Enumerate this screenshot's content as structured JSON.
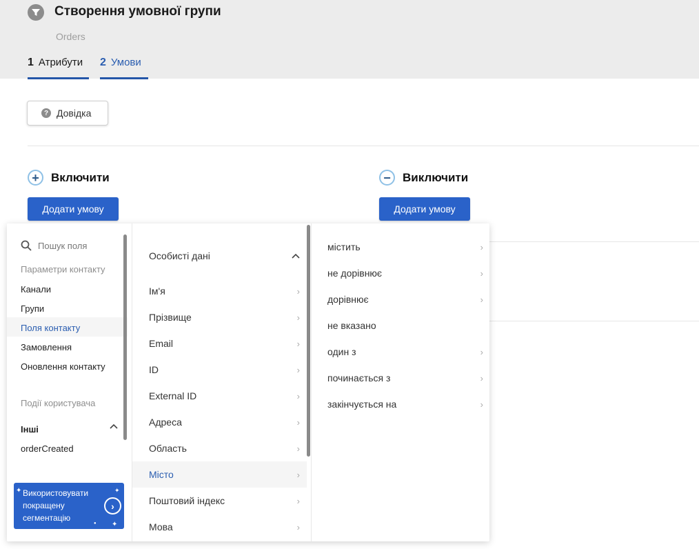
{
  "header": {
    "title": "Створення умовної групи",
    "subtitle": "Orders",
    "steps": [
      {
        "num": "1",
        "label": "Атрибути"
      },
      {
        "num": "2",
        "label": "Умови"
      }
    ]
  },
  "help_label": "Довідка",
  "include": {
    "label": "Включити",
    "button": "Додати умову"
  },
  "exclude": {
    "label": "Виключити",
    "button": "Додати умову"
  },
  "field_menu": {
    "search_placeholder": "Пошук поля",
    "contact_params_label": "Параметри контакту",
    "contact_items": [
      "Канали",
      "Групи",
      "Поля контакту",
      "Замовлення",
      "Оновлення контакту"
    ],
    "user_events_label": "Події користувача",
    "others_label": "Інші",
    "others_items": [
      "orderCreated"
    ],
    "promo_text": "Використовувати покращену сегментацію"
  },
  "personal_data": {
    "group_label": "Особисті дані",
    "fields": [
      "Ім'я",
      "Прізвище",
      "Email",
      "ID",
      "External ID",
      "Адреса",
      "Область",
      "Місто",
      "Поштовий індекс",
      "Мова"
    ]
  },
  "operators": [
    "містить",
    "не дорівнює",
    "дорівнює",
    "не вказано",
    "один з",
    "починається з",
    "закінчується на"
  ],
  "colors": {
    "accent": "#2a62c9",
    "active_text": "#2a5db0"
  }
}
